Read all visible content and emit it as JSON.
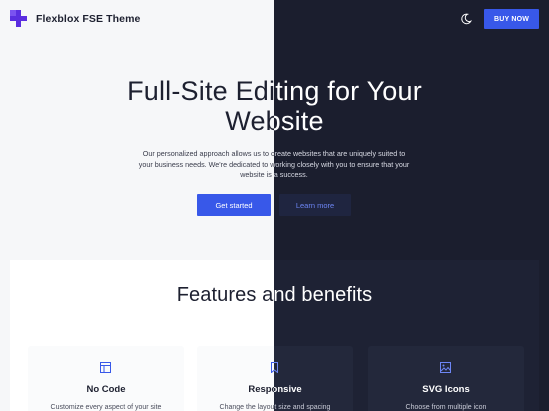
{
  "header": {
    "brand": "Flexblox FSE Theme",
    "buy_label": "BUY NOW",
    "logo_icon": "flexblox-logo-icon",
    "theme_toggle_icon": "moon-icon"
  },
  "hero": {
    "title_line1": "Full-Site Editing for Your",
    "title_line2": "Website",
    "desc_line1": "Our personalized approach allows us to create websites that are uniquely suited to",
    "desc_line2": "your business needs. We're dedicated to working closely with you to ensure that your",
    "desc_line3": "website is a success.",
    "primary_label": "Get started",
    "secondary_label": "Learn more"
  },
  "features": {
    "title": "Features and benefits",
    "cards": [
      {
        "title": "No Code",
        "desc": "Customize every aspect of your site",
        "icon": "layout-icon"
      },
      {
        "title": "Responsive",
        "desc": "Change the layout size and spacing",
        "icon": "bookmark-icon"
      },
      {
        "title": "SVG Icons",
        "desc": "Choose from multiple icon",
        "icon": "image-icon"
      }
    ]
  },
  "colors": {
    "accent": "#3858e9",
    "dark_bg": "#1b1e2e",
    "light_bg": "#f6f7f9"
  }
}
